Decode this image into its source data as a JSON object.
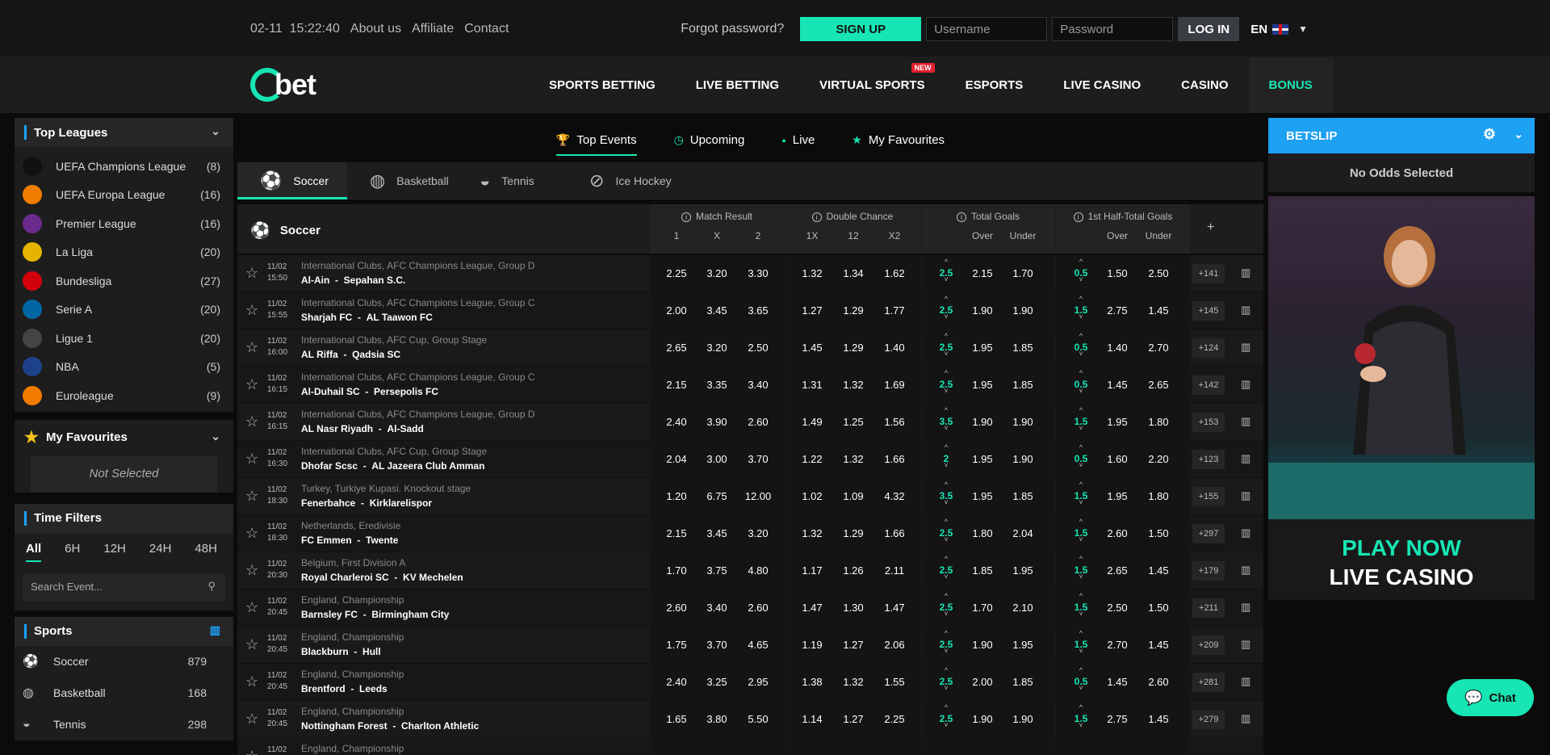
{
  "topbar": {
    "datetime": "02-11  15:22:40",
    "links": [
      "About us",
      "Affiliate",
      "Contact"
    ],
    "forgot": "Forgot password?",
    "signup": "SIGN UP",
    "username_placeholder": "Username",
    "password_placeholder": "Password",
    "login": "LOG IN",
    "lang": "EN"
  },
  "nav": {
    "logo": "bet",
    "items": [
      "SPORTS BETTING",
      "LIVE BETTING",
      "VIRTUAL SPORTS",
      "ESPORTS",
      "LIVE CASINO",
      "CASINO",
      "BONUS"
    ],
    "new_badge": "NEW"
  },
  "leagues": {
    "title": "Top Leagues",
    "items": [
      {
        "name": "UEFA Champions League",
        "count": "(8)",
        "color": "#111111"
      },
      {
        "name": "UEFA Europa League",
        "count": "(16)",
        "color": "#f07c00"
      },
      {
        "name": "Premier League",
        "count": "(16)",
        "color": "#6a2b8c"
      },
      {
        "name": "La Liga",
        "count": "(20)",
        "color": "#e5b400"
      },
      {
        "name": "Bundesliga",
        "count": "(27)",
        "color": "#d3010c"
      },
      {
        "name": "Serie A",
        "count": "(20)",
        "color": "#0067a3"
      },
      {
        "name": "Ligue 1",
        "count": "(20)",
        "color": "#444444"
      },
      {
        "name": "NBA",
        "count": "(5)",
        "color": "#1d428a"
      },
      {
        "name": "Euroleague",
        "count": "(9)",
        "color": "#f27c00"
      }
    ]
  },
  "favourites": {
    "title": "My Favourites",
    "empty": "Not Selected"
  },
  "timefilters": {
    "title": "Time Filters",
    "options": [
      "All",
      "6H",
      "12H",
      "24H",
      "48H"
    ],
    "search_placeholder": "Search Event..."
  },
  "sports": {
    "title": "Sports",
    "items": [
      {
        "name": "Soccer",
        "count": "879"
      },
      {
        "name": "Basketball",
        "count": "168"
      },
      {
        "name": "Tennis",
        "count": "298"
      }
    ]
  },
  "subtabs": [
    "Top Events",
    "Upcoming",
    "Live",
    "My Favourites"
  ],
  "sporttabs": [
    "Soccer",
    "Basketball",
    "Tennis",
    "Ice Hockey"
  ],
  "grid": {
    "sport": "Soccer",
    "groups": {
      "mr": {
        "title": "Match Result",
        "cols": [
          "1",
          "X",
          "2"
        ]
      },
      "dc": {
        "title": "Double Chance",
        "cols": [
          "1X",
          "12",
          "X2"
        ]
      },
      "tg": {
        "title": "Total Goals",
        "cols": [
          "Over",
          "Under"
        ]
      },
      "ht": {
        "title": "1st Half-Total Goals",
        "cols": [
          "Over",
          "Under"
        ]
      }
    },
    "plus": "+"
  },
  "matches": [
    {
      "date": "11/02",
      "time": "15:50",
      "comp": "International Clubs, AFC Champions League, Group D",
      "home": "Al-Ain",
      "away": "Sepahan S.C.",
      "mr": [
        "2.25",
        "3.20",
        "3.30"
      ],
      "dc": [
        "1.32",
        "1.34",
        "1.62"
      ],
      "tgl": "2.5",
      "tg": [
        "2.15",
        "1.70"
      ],
      "htl": "0.5",
      "ht": [
        "1.50",
        "2.50"
      ],
      "more": "+141"
    },
    {
      "date": "11/02",
      "time": "15:55",
      "comp": "International Clubs, AFC Champions League, Group C",
      "home": "Sharjah FC",
      "away": "AL Taawon FC",
      "mr": [
        "2.00",
        "3.45",
        "3.65"
      ],
      "dc": [
        "1.27",
        "1.29",
        "1.77"
      ],
      "tgl": "2.5",
      "tg": [
        "1.90",
        "1.90"
      ],
      "htl": "1.5",
      "ht": [
        "2.75",
        "1.45"
      ],
      "more": "+145"
    },
    {
      "date": "11/02",
      "time": "16:00",
      "comp": "International Clubs, AFC Cup, Group Stage",
      "home": "AL Riffa",
      "away": "Qadsia SC",
      "mr": [
        "2.65",
        "3.20",
        "2.50"
      ],
      "dc": [
        "1.45",
        "1.29",
        "1.40"
      ],
      "tgl": "2.5",
      "tg": [
        "1.95",
        "1.85"
      ],
      "htl": "0.5",
      "ht": [
        "1.40",
        "2.70"
      ],
      "more": "+124"
    },
    {
      "date": "11/02",
      "time": "16:15",
      "comp": "International Clubs, AFC Champions League, Group C",
      "home": "Al-Duhail SC",
      "away": "Persepolis FC",
      "mr": [
        "2.15",
        "3.35",
        "3.40"
      ],
      "dc": [
        "1.31",
        "1.32",
        "1.69"
      ],
      "tgl": "2.5",
      "tg": [
        "1.95",
        "1.85"
      ],
      "htl": "0.5",
      "ht": [
        "1.45",
        "2.65"
      ],
      "more": "+142"
    },
    {
      "date": "11/02",
      "time": "16:15",
      "comp": "International Clubs, AFC Champions League, Group D",
      "home": "AL Nasr Riyadh",
      "away": "Al-Sadd",
      "mr": [
        "2.40",
        "3.90",
        "2.60"
      ],
      "dc": [
        "1.49",
        "1.25",
        "1.56"
      ],
      "tgl": "3.5",
      "tg": [
        "1.90",
        "1.90"
      ],
      "htl": "1.5",
      "ht": [
        "1.95",
        "1.80"
      ],
      "more": "+153"
    },
    {
      "date": "11/02",
      "time": "16:30",
      "comp": "International Clubs, AFC Cup, Group Stage",
      "home": "Dhofar Scsc",
      "away": "AL Jazeera Club Amman",
      "mr": [
        "2.04",
        "3.00",
        "3.70"
      ],
      "dc": [
        "1.22",
        "1.32",
        "1.66"
      ],
      "tgl": "2",
      "tg": [
        "1.95",
        "1.90"
      ],
      "htl": "0.5",
      "ht": [
        "1.60",
        "2.20"
      ],
      "more": "+123"
    },
    {
      "date": "11/02",
      "time": "18:30",
      "comp": "Turkey, Turkiye Kupasi. Knockout stage",
      "home": "Fenerbahce",
      "away": "Kirklarelispor",
      "mr": [
        "1.20",
        "6.75",
        "12.00"
      ],
      "dc": [
        "1.02",
        "1.09",
        "4.32"
      ],
      "tgl": "3.5",
      "tg": [
        "1.95",
        "1.85"
      ],
      "htl": "1.5",
      "ht": [
        "1.95",
        "1.80"
      ],
      "more": "+155"
    },
    {
      "date": "11/02",
      "time": "18:30",
      "comp": "Netherlands, Eredivisie",
      "home": "FC Emmen",
      "away": "Twente",
      "mr": [
        "2.15",
        "3.45",
        "3.20"
      ],
      "dc": [
        "1.32",
        "1.29",
        "1.66"
      ],
      "tgl": "2.5",
      "tg": [
        "1.80",
        "2.04"
      ],
      "htl": "1.5",
      "ht": [
        "2.60",
        "1.50"
      ],
      "more": "+297"
    },
    {
      "date": "11/02",
      "time": "20:30",
      "comp": "Belgium, First Division A",
      "home": "Royal Charleroi SC",
      "away": "KV Mechelen",
      "mr": [
        "1.70",
        "3.75",
        "4.80"
      ],
      "dc": [
        "1.17",
        "1.26",
        "2.11"
      ],
      "tgl": "2.5",
      "tg": [
        "1.85",
        "1.95"
      ],
      "htl": "1.5",
      "ht": [
        "2.65",
        "1.45"
      ],
      "more": "+179"
    },
    {
      "date": "11/02",
      "time": "20:45",
      "comp": "England, Championship",
      "home": "Barnsley FC",
      "away": "Birmingham City",
      "mr": [
        "2.60",
        "3.40",
        "2.60"
      ],
      "dc": [
        "1.47",
        "1.30",
        "1.47"
      ],
      "tgl": "2.5",
      "tg": [
        "1.70",
        "2.10"
      ],
      "htl": "1.5",
      "ht": [
        "2.50",
        "1.50"
      ],
      "more": "+211"
    },
    {
      "date": "11/02",
      "time": "20:45",
      "comp": "England, Championship",
      "home": "Blackburn",
      "away": "Hull",
      "mr": [
        "1.75",
        "3.70",
        "4.65"
      ],
      "dc": [
        "1.19",
        "1.27",
        "2.06"
      ],
      "tgl": "2.5",
      "tg": [
        "1.90",
        "1.95"
      ],
      "htl": "1.5",
      "ht": [
        "2.70",
        "1.45"
      ],
      "more": "+209"
    },
    {
      "date": "11/02",
      "time": "20:45",
      "comp": "England, Championship",
      "home": "Brentford",
      "away": "Leeds",
      "mr": [
        "2.40",
        "3.25",
        "2.95"
      ],
      "dc": [
        "1.38",
        "1.32",
        "1.55"
      ],
      "tgl": "2.5",
      "tg": [
        "2.00",
        "1.85"
      ],
      "htl": "0.5",
      "ht": [
        "1.45",
        "2.60"
      ],
      "more": "+281"
    },
    {
      "date": "11/02",
      "time": "20:45",
      "comp": "England, Championship",
      "home": "Nottingham Forest",
      "away": "Charlton Athletic",
      "mr": [
        "1.65",
        "3.80",
        "5.50"
      ],
      "dc": [
        "1.14",
        "1.27",
        "2.25"
      ],
      "tgl": "2.5",
      "tg": [
        "1.90",
        "1.90"
      ],
      "htl": "1.5",
      "ht": [
        "2.75",
        "1.45"
      ],
      "more": "+279"
    },
    {
      "date": "11/02",
      "time": "",
      "comp": "England, Championship",
      "home": "",
      "away": "",
      "mr": [
        "",
        "",
        ""
      ],
      "dc": [
        "",
        "",
        ""
      ],
      "tgl": "",
      "tg": [
        "",
        ""
      ],
      "htl": "",
      "ht": [
        "",
        ""
      ],
      "more": ""
    }
  ],
  "betslip": {
    "title": "BETSLIP",
    "empty": "No Odds Selected"
  },
  "banner": {
    "line1": "PLAY NOW",
    "line2": "LIVE CASINO"
  },
  "chat": {
    "label": "Chat"
  }
}
